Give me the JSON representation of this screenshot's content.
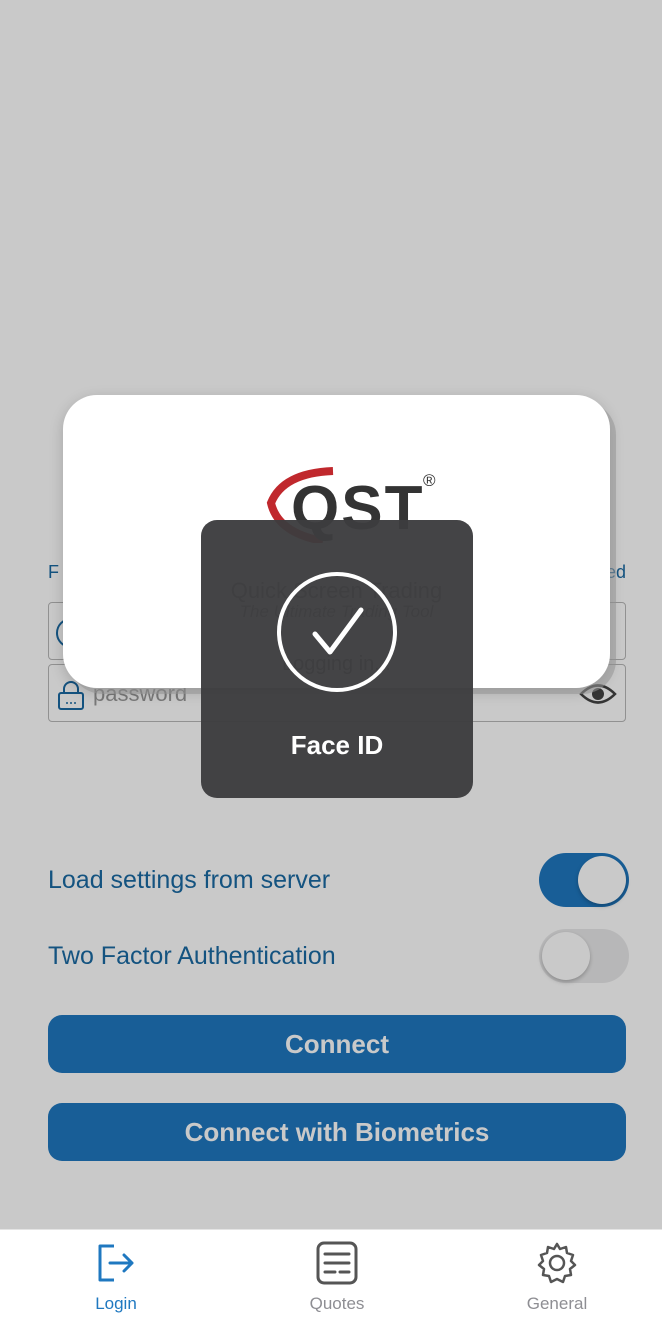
{
  "login": {
    "left_label": "F",
    "right_label": "ed",
    "password_placeholder": "password"
  },
  "settings": {
    "load_label": "Load settings from server",
    "load_on": true,
    "twofa_label": "Two Factor Authentication",
    "twofa_on": false
  },
  "buttons": {
    "connect": "Connect",
    "biometrics": "Connect with Biometrics"
  },
  "splash": {
    "logo_text": "QST",
    "registered": "®",
    "tagline": "Quick Screen Trading",
    "subtagline": "The Ultimate Trading Tool",
    "status": "Logging in..."
  },
  "face_id": {
    "label": "Face ID"
  },
  "tabs": [
    {
      "label": "Login",
      "icon": "login-icon",
      "active": true
    },
    {
      "label": "Quotes",
      "icon": "quotes-icon",
      "active": false
    },
    {
      "label": "General",
      "icon": "gear-icon",
      "active": false
    }
  ],
  "colors": {
    "accent": "#1f78c0",
    "text_blue": "#1a6aa3",
    "hud": "#3c3c3e"
  }
}
